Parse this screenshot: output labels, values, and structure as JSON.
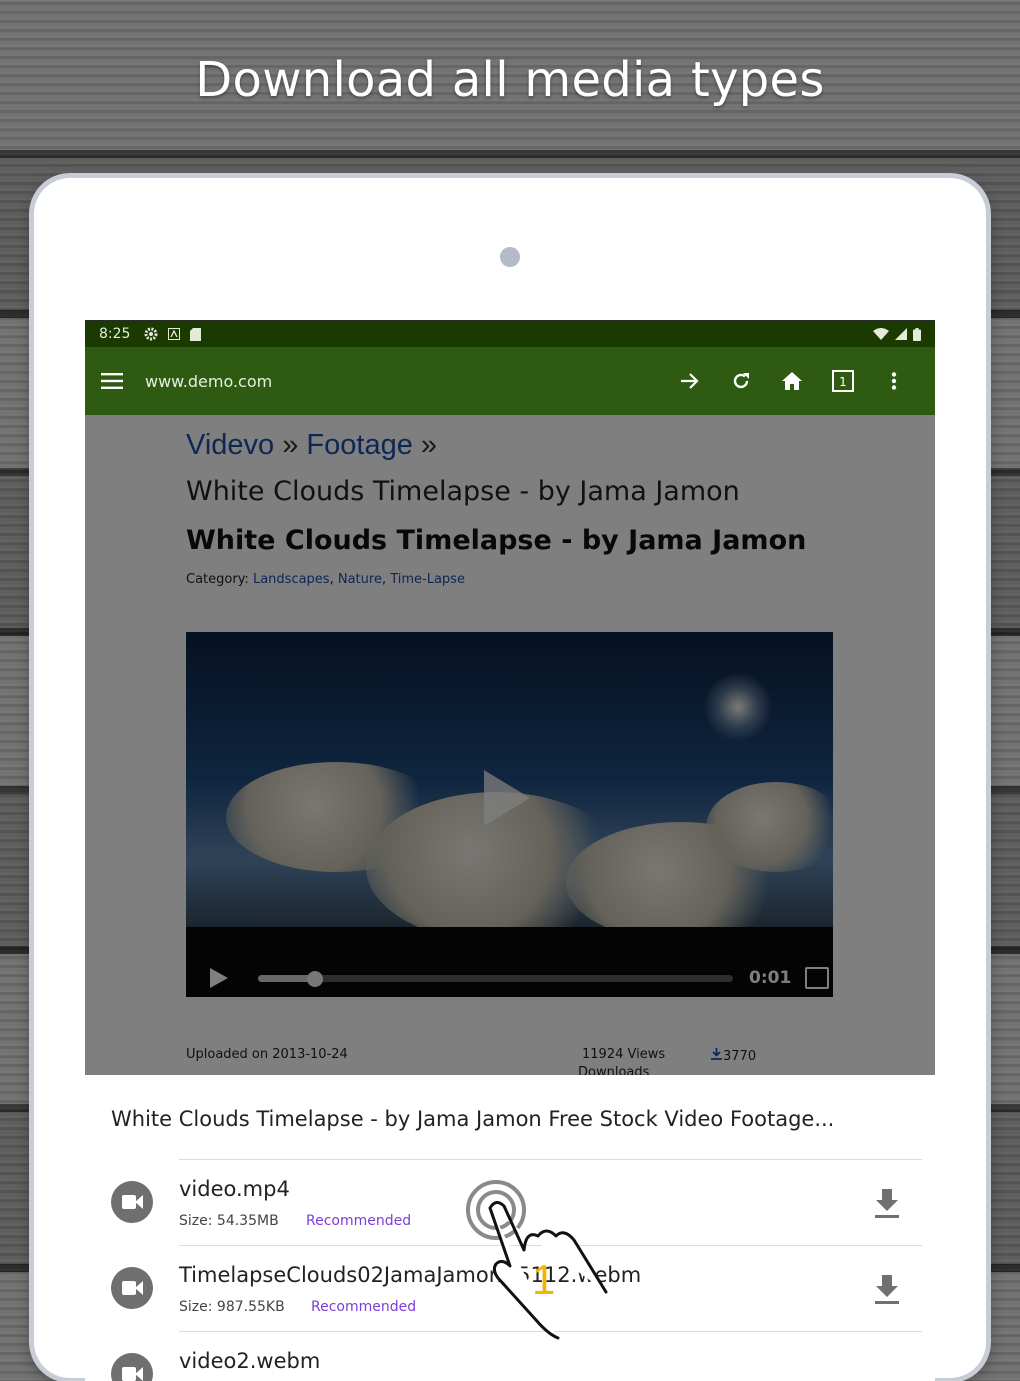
{
  "headline": "Download all media types",
  "status_bar": {
    "time": "8:25",
    "left_icons": [
      "gear-icon",
      "a-icon",
      "sd-card-icon"
    ],
    "right_icons": [
      "wifi-icon",
      "cell-signal-icon",
      "battery-icon"
    ]
  },
  "browser": {
    "url": "www.demo.com",
    "tab_count": "1",
    "actions": [
      "menu-icon",
      "forward-icon",
      "reload-icon",
      "home-icon",
      "tabs-icon",
      "overflow-icon"
    ]
  },
  "page": {
    "breadcrumb": {
      "item1": "Videvo",
      "sep1": "»",
      "item2": "Footage",
      "sep2": "»"
    },
    "title_light": "White Clouds Timelapse - by Jama Jamon",
    "title_bold": "White Clouds Timelapse - by Jama Jamon",
    "category_label": "Category:",
    "categories": [
      "Landscapes",
      "Nature",
      "Time-Lapse"
    ],
    "player": {
      "time": "0:01",
      "progress": 0.12
    },
    "uploaded": "Uploaded on 2013-10-24",
    "views": "11924 Views",
    "downloads_count": "3770",
    "downloads_label": "Downloads"
  },
  "sheet": {
    "title": "White Clouds Timelapse - by Jama Jamon Free Stock Video Footage...",
    "items": [
      {
        "name": "video.mp4",
        "size": "Size: 54.35MB",
        "tag": "Recommended"
      },
      {
        "name": "TimelapseClouds02JamaJamon--5112.webm",
        "size": "Size: 987.55KB",
        "tag": "Recommended"
      },
      {
        "name": "video2.webm",
        "size": "",
        "tag": ""
      }
    ]
  },
  "tutorial": {
    "step": "1"
  },
  "colors": {
    "status_bar": "#1b3a00",
    "toolbar": "#2e5a12",
    "link": "#1f4fa8",
    "recommended": "#7b3fd6",
    "step_number": "#f4b400"
  }
}
